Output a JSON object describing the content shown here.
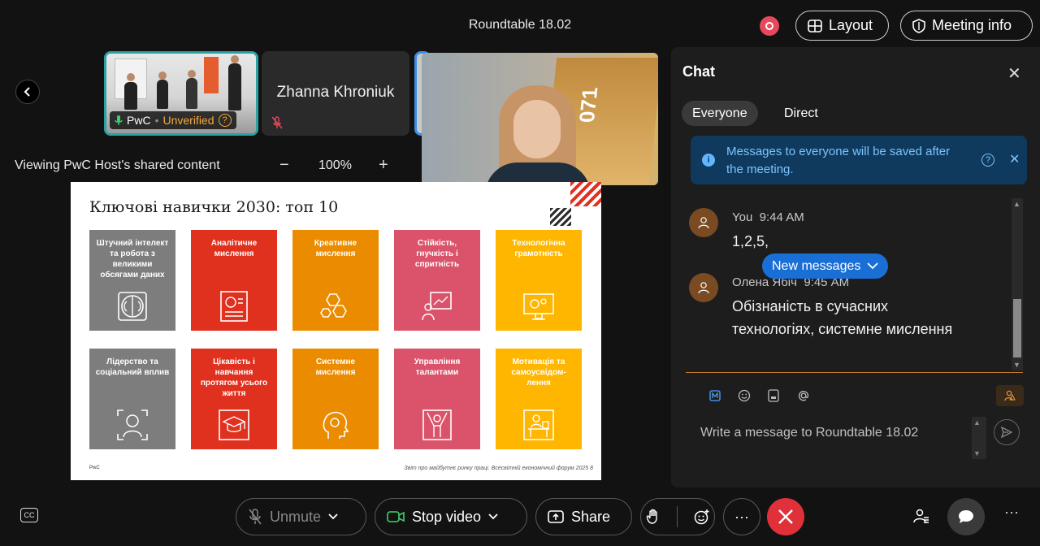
{
  "header": {
    "meeting_title": "Roundtable 18.02",
    "layout_label": "Layout",
    "meeting_info_label": "Meeting info",
    "record_color": "#e8485c"
  },
  "thumbnails": [
    {
      "name": "PwC",
      "status": "Unverified",
      "icon": "microphone-on-icon",
      "accent": "#2aa1a3"
    },
    {
      "name": "Zhanna Khroniuk",
      "icon": "microphone-muted-icon"
    }
  ],
  "self_view": {
    "poster_text": "071"
  },
  "share_bar": {
    "viewing_text": "Viewing PwC Host's shared content",
    "zoom_minus": "−",
    "zoom_value": "100%",
    "zoom_plus": "+"
  },
  "slide": {
    "title": "Ключові навички 2030: топ 10",
    "footer_left": "PwC",
    "footer_right": "Звіт про майбутнє ринку праці. Всесвітній економічний форум 2025   8",
    "tiles": [
      {
        "label": "Штучний інтелект та робота з великими обсягами даних",
        "color": "#7d7d7d",
        "icon": "brain-circuit-icon"
      },
      {
        "label": "Аналітичне мислення",
        "color": "#e0301e",
        "icon": "analytics-chart-icon"
      },
      {
        "label": "Креативне мислення",
        "color": "#eb8c00",
        "icon": "hexagon-idea-icon"
      },
      {
        "label": "Стійкість, гнучкість і спритність",
        "color": "#db536a",
        "icon": "presenter-growth-icon"
      },
      {
        "label": "Технологічна грамотність",
        "color": "#ffb600",
        "icon": "monitor-gears-icon"
      },
      {
        "label": "Лідерство та соціальний вплив",
        "color": "#7d7d7d",
        "icon": "leader-focus-icon"
      },
      {
        "label": "Цікавість і навчання протягом усього життя",
        "color": "#e0301e",
        "icon": "graduation-cap-icon"
      },
      {
        "label": "Системне мислення",
        "color": "#eb8c00",
        "icon": "head-gear-icon"
      },
      {
        "label": "Управління талантами",
        "color": "#db536a",
        "icon": "talent-person-icon"
      },
      {
        "label": "Мотивація та самоусвідом-лення",
        "color": "#ffb600",
        "icon": "desk-worker-icon"
      }
    ]
  },
  "chat": {
    "title": "Chat",
    "tabs": [
      "Everyone",
      "Direct"
    ],
    "notice": "Messages to everyone will be saved after the meeting.",
    "messages": [
      {
        "author": "You",
        "time": "9:44 AM",
        "text": "1,2,5,"
      },
      {
        "author": "Олена Ябіч",
        "time": "9:45 AM",
        "text_line1": "Обізнаність в сучасних",
        "text_line2": "технологіях, системне мислення"
      }
    ],
    "new_messages_label": "New messages",
    "input_placeholder": "Write a message to Roundtable 18.02",
    "accent": "#c77d2a"
  },
  "controls": {
    "unmute_label": "Unmute",
    "stop_video_label": "Stop video",
    "share_label": "Share",
    "more_label": "···",
    "leave_color": "#e0303a",
    "cc_label": "CC"
  }
}
